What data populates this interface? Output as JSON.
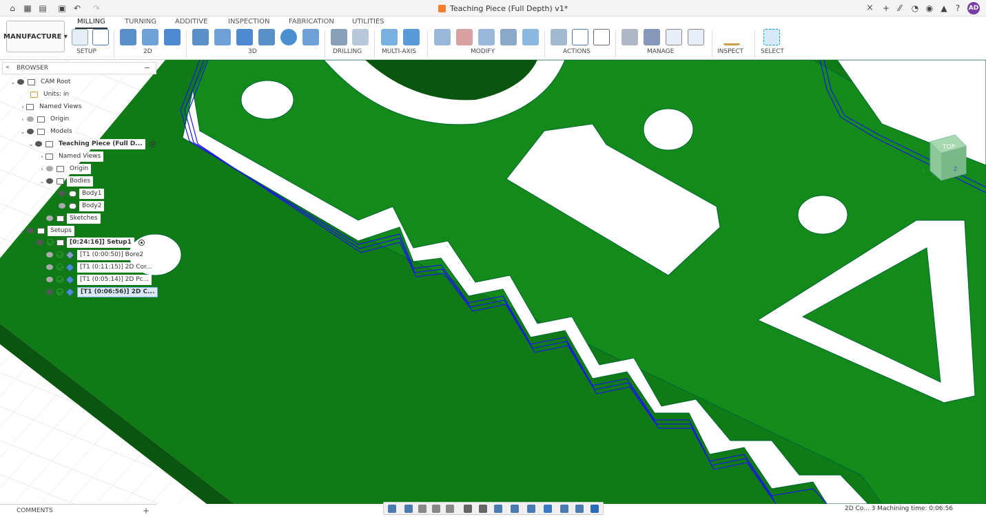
{
  "titlebar": {
    "document_title": "Teaching Piece (Full Depth) v1*",
    "close_glyph": "×",
    "avatar_initials": "AD"
  },
  "workspace": {
    "label": "MANUFACTURE"
  },
  "tabs": [
    "MILLING",
    "TURNING",
    "ADDITIVE",
    "INSPECTION",
    "FABRICATION",
    "UTILITIES"
  ],
  "groups": {
    "setup": "SETUP",
    "g2d": "2D",
    "g3d": "3D",
    "drilling": "DRILLING",
    "multiaxis": "MULTI-AXIS",
    "modify": "MODIFY",
    "actions": "ACTIONS",
    "manage": "MANAGE",
    "inspect": "INSPECT",
    "select": "SELECT"
  },
  "browser": {
    "title": "BROWSER",
    "collapse": "«",
    "minimize": "−",
    "cam_root": "CAM Root",
    "units": "Units: in",
    "named_views": "Named Views",
    "origin": "Origin",
    "models": "Models",
    "model_name": "Teaching Piece (Full D...",
    "model_named_views": "Named Views",
    "model_origin": "Origin",
    "bodies": "Bodies",
    "body1": "Body1",
    "body2": "Body2",
    "sketches": "Sketches",
    "setups": "Setups",
    "setup1": "[0:24:16]] Setup1",
    "ops": [
      "[T1 (0:00:50)] Bore2",
      "[T1 (0:11:15)] 2D Cor...",
      "[T1 (0:05:14)] 2D Pc...",
      "[T1 (0:06:56)] 2D C..."
    ]
  },
  "comments": {
    "label": "COMMENTS",
    "add": "+"
  },
  "status": {
    "text": "2D Co... 3 Machining time: 0:06:56"
  },
  "viewcube": {
    "label": "TOP",
    "axis_y": "Y",
    "axis_z": "Z"
  },
  "colors": {
    "stock_green": "#0f7a16",
    "toolpath_blue": "#1a1ae0",
    "accent": "#0696d7"
  }
}
